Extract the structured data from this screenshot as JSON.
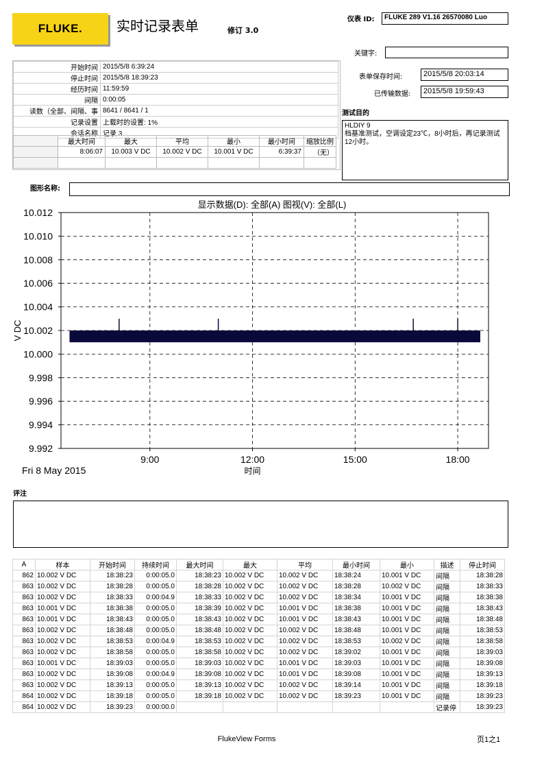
{
  "header": {
    "logo_text": "FLUKE.",
    "title": "实时记录表单",
    "revision": "修订 3.0",
    "instrument_label": "仪表 ID:",
    "instrument_value": "FLUKE 289  V1.16  26570080 Luo",
    "keyword_label": "关键字:",
    "keyword_value": "",
    "save_time_label": "表单保存时间:",
    "save_time_value": "2015/5/8 20:03:14",
    "transfer_label": "已传输数据:",
    "transfer_value": "2015/5/8 19:59:43"
  },
  "info": [
    {
      "label": "开始时间",
      "value": "2015/5/8 6:39:24"
    },
    {
      "label": "停止时间",
      "value": "2015/5/8 18:39:23"
    },
    {
      "label": "经历时间",
      "value": "11:59:59"
    },
    {
      "label": "间隔",
      "value": "0:00:05"
    },
    {
      "label": "读数（全部、间隔、事",
      "value": "8641 / 8641 / 1"
    },
    {
      "label": "记录设置",
      "value": "上载时的设置:   1%"
    },
    {
      "label": "会话名称",
      "value": "记录 3"
    }
  ],
  "stats": {
    "headers": [
      "最大时间",
      "最大",
      "平均",
      "最小",
      "最小时间",
      "缩放比例"
    ],
    "row": [
      "8:06:07",
      "10.003 V DC",
      "10.002 V DC",
      "10.001 V DC",
      "6:39:37",
      "（无）"
    ]
  },
  "purpose": {
    "label": "测试目的",
    "text": "HLDIY 9\n档基准测试，空调设定23℃，8小时后，再记录测试12小时。"
  },
  "graph_name_label": "图形名称:",
  "chart_subtitle": "显示数据(D): 全部(A)    图视(V): 全部(L)",
  "chart_data": {
    "type": "line",
    "title": "",
    "xlabel": "时间",
    "ylabel": "V DC",
    "date_label": "Fri 8 May 2015",
    "ylim": [
      9.992,
      10.012
    ],
    "y_ticks": [
      "10.012",
      "10.010",
      "10.008",
      "10.006",
      "10.004",
      "10.002",
      "10.000",
      "9.998",
      "9.996",
      "9.994",
      "9.992"
    ],
    "x_ticks": [
      "9:00",
      "12:00",
      "15:00",
      "18:00"
    ],
    "x_range_hours": [
      6.4,
      18.9
    ],
    "series": [
      {
        "type": "band",
        "start": 6.65,
        "end": 18.66,
        "low": 10.001,
        "high": 10.002
      }
    ],
    "spikes": [
      {
        "t": 8.1,
        "value": 10.003
      },
      {
        "t": 11.0,
        "value": 10.003
      },
      {
        "t": 16.7,
        "value": 10.003
      },
      {
        "t": 18.0,
        "value": 10.003
      }
    ],
    "band_color": "#0a0a3a"
  },
  "comments_label": "评注",
  "table": {
    "headers": [
      "A",
      "样本",
      "开始时间",
      "持续时间",
      "最大时间",
      "最大",
      "平均",
      "最小时间",
      "最小",
      "描述",
      "停止时间"
    ],
    "rows": [
      [
        "862",
        "10.002 V DC",
        "18:38:23",
        "0:00:05.0",
        "18:38:23",
        "10.002 V DC",
        "10.002 V DC",
        "18:38:24",
        "10.001 V DC",
        "间隔",
        "18:38:28"
      ],
      [
        "863",
        "10.002 V DC",
        "18:38:28",
        "0:00:05.0",
        "18:38:28",
        "10.002 V DC",
        "10.002 V DC",
        "18:38:28",
        "10.002 V DC",
        "间隔",
        "18:38:33"
      ],
      [
        "863",
        "10.002 V DC",
        "18:38:33",
        "0:00:04.9",
        "18:38:33",
        "10.002 V DC",
        "10.002 V DC",
        "18:38:34",
        "10.001 V DC",
        "间隔",
        "18:38:38"
      ],
      [
        "863",
        "10.001 V DC",
        "18:38:38",
        "0:00:05.0",
        "18:38:39",
        "10.002 V DC",
        "10.001 V DC",
        "18:38:38",
        "10.001 V DC",
        "间隔",
        "18:38:43"
      ],
      [
        "863",
        "10.001 V DC",
        "18:38:43",
        "0:00:05.0",
        "18:38:43",
        "10.002 V DC",
        "10.001 V DC",
        "18:38:43",
        "10.001 V DC",
        "间隔",
        "18:38:48"
      ],
      [
        "863",
        "10.002 V DC",
        "18:38:48",
        "0:00:05.0",
        "18:38:48",
        "10.002 V DC",
        "10.002 V DC",
        "18:38:48",
        "10.001 V DC",
        "间隔",
        "18:38:53"
      ],
      [
        "863",
        "10.002 V DC",
        "18:38:53",
        "0:00:04.9",
        "18:38:53",
        "10.002 V DC",
        "10.002 V DC",
        "18:38:53",
        "10.002 V DC",
        "间隔",
        "18:38:58"
      ],
      [
        "863",
        "10.002 V DC",
        "18:38:58",
        "0:00:05.0",
        "18:38:58",
        "10.002 V DC",
        "10.002 V DC",
        "18:39:02",
        "10.001 V DC",
        "间隔",
        "18:39:03"
      ],
      [
        "863",
        "10.001 V DC",
        "18:39:03",
        "0:00:05.0",
        "18:39:03",
        "10.002 V DC",
        "10.001 V DC",
        "18:39:03",
        "10.001 V DC",
        "间隔",
        "18:39:08"
      ],
      [
        "863",
        "10.002 V DC",
        "18:39:08",
        "0:00:04.9",
        "18:39:08",
        "10.002 V DC",
        "10.001 V DC",
        "18:39:08",
        "10.001 V DC",
        "间隔",
        "18:39:13"
      ],
      [
        "863",
        "10.002 V DC",
        "18:39:13",
        "0:00:05.0",
        "18:39:13",
        "10.002 V DC",
        "10.002 V DC",
        "18:39:14",
        "10.001 V DC",
        "间隔",
        "18:39:18"
      ],
      [
        "864",
        "10.002 V DC",
        "18:39:18",
        "0:00:05.0",
        "18:39:18",
        "10.002 V DC",
        "10.002 V DC",
        "18:39:23",
        "10.001 V DC",
        "间隔",
        "18:39:23"
      ],
      [
        "864",
        "10.002 V DC",
        "18:39:23",
        "0:00:00.0",
        "",
        "",
        "",
        "",
        "",
        "记录停",
        "18:39:23"
      ]
    ]
  },
  "footer": {
    "center": "FlukeView Forms",
    "page": "页1之1"
  }
}
